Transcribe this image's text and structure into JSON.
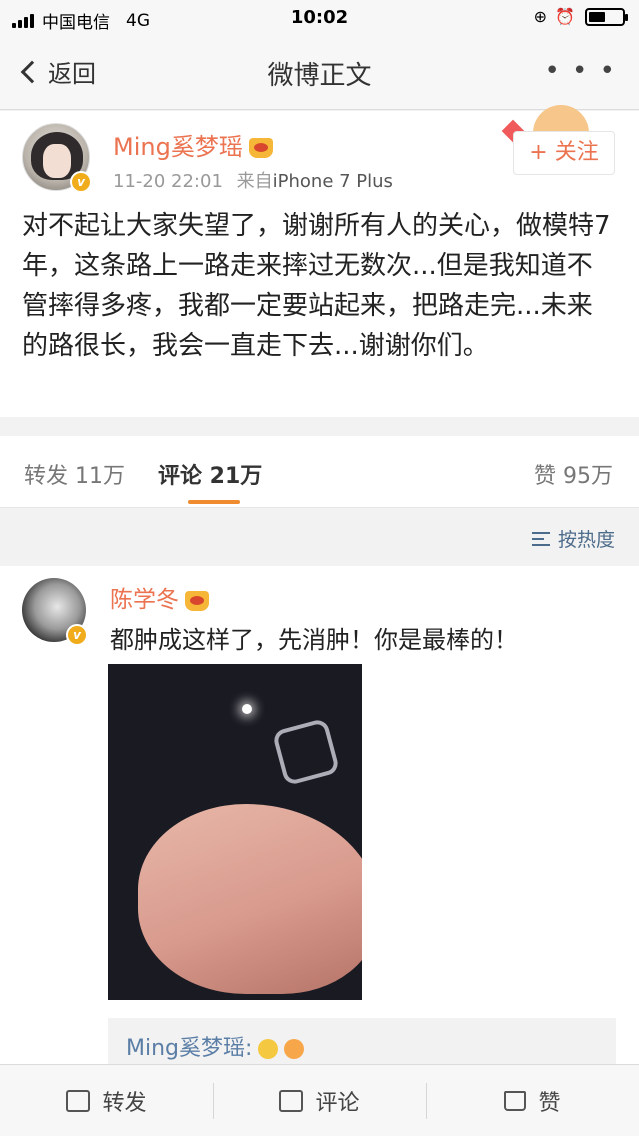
{
  "status_bar": {
    "carrier": "中国电信",
    "network": "4G",
    "time": "10:02",
    "battery_level": 0.5
  },
  "nav": {
    "back_label": "返回",
    "title": "微博正文",
    "more_label": "• • •"
  },
  "post": {
    "username": "Ming奚梦瑶",
    "time": "11-20 22:01",
    "source_prefix": "来自",
    "source": "iPhone 7 Plus",
    "follow_label": "+ 关注",
    "text": "对不起让大家失望了，谢谢所有人的关心，做模特7年，这条路上一路走来摔过无数次...但是我知道不管摔得多疼，我都一定要站起来，把路走完...未来的路很长，我会一直走下去...谢谢你们。"
  },
  "stats": {
    "repost": "转发 11万",
    "comment": "评论 21万",
    "like": "赞 95万"
  },
  "sort": {
    "label": "按热度"
  },
  "comment": {
    "username": "陈学冬",
    "text": "都肿成这样了，先消肿！你是最棒的！",
    "reply_name": "Ming奚梦瑶:"
  },
  "toolbar": {
    "repost_label": "转发",
    "comment_label": "评论",
    "like_label": "赞"
  },
  "colors": {
    "accent": "#eb7350",
    "link": "#5b7ea6",
    "tab_underline": "#f18b2f"
  }
}
